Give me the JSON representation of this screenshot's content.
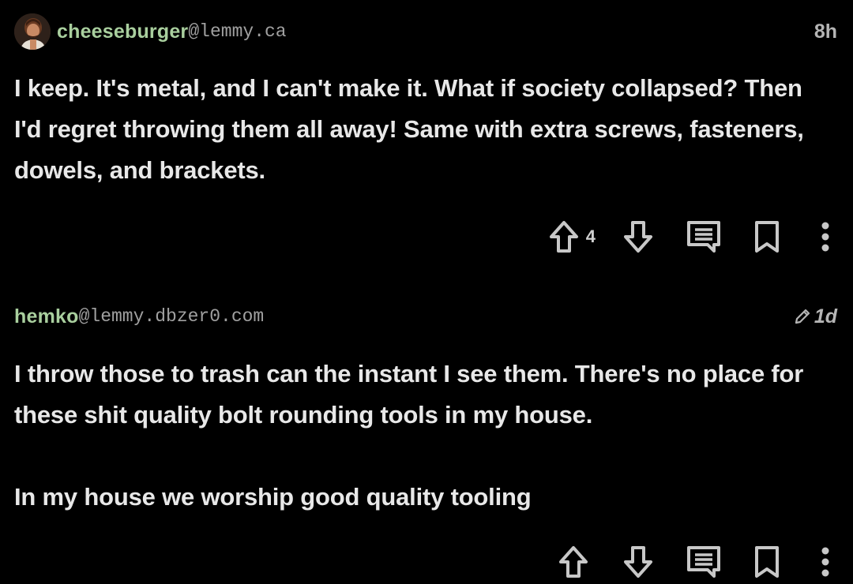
{
  "comments": [
    {
      "username": "cheeseburger",
      "instance": "@lemmy.ca",
      "time": "8h",
      "edited": false,
      "has_avatar": true,
      "paragraphs": [
        "I keep. It's metal, and I can't make it. What if society collapsed? Then I'd regret throwing them all away! Same with extra screws, fasteners, dowels, and brackets."
      ],
      "upvotes": "4",
      "actions": [
        "upvote-icon",
        "downvote-icon",
        "reply-icon",
        "bookmark-icon",
        "more-options-icon"
      ]
    },
    {
      "username": "hemko",
      "instance": "@lemmy.dbzer0.com",
      "time": "1d",
      "edited": true,
      "has_avatar": false,
      "paragraphs": [
        "I throw those to trash can the instant I see them. There's no place for these shit quality bolt rounding tools in my house.",
        "In my house we worship good quality tooling"
      ]
    }
  ],
  "colors": {
    "background": "#000000",
    "username": "#a9cf9e",
    "instance": "#a0a0a0",
    "body_text": "#e8e8e8",
    "icon": "#c8c8c8"
  }
}
